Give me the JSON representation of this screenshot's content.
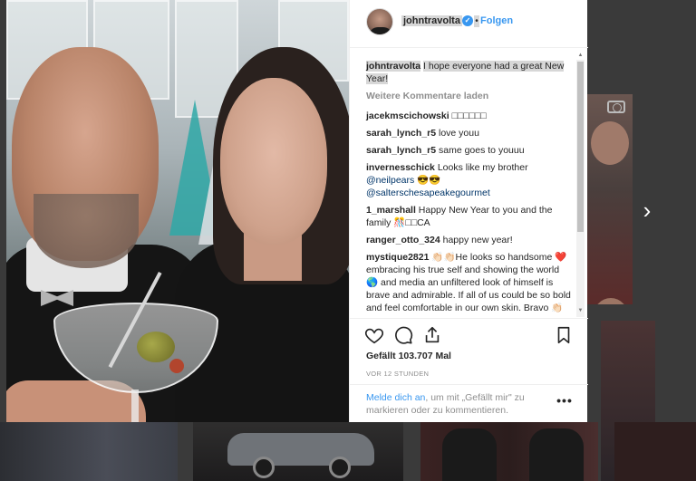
{
  "post": {
    "username": "johntravolta",
    "separator": "•",
    "follow_label": "Folgen",
    "caption_user": "johntravolta",
    "caption_text": "I hope everyone had a great New Year!",
    "load_more_label": "Weitere Kommentare laden",
    "comments": [
      {
        "user": "jacekmscichowski",
        "text": "□□□□□□"
      },
      {
        "user": "sarah_lynch_r5",
        "text": "love youu"
      },
      {
        "user": "sarah_lynch_r5",
        "text": "same goes to youuu"
      },
      {
        "user": "invernesschick",
        "text": "Looks like my brother",
        "mention1": "@neilpears",
        "emoji": "😎😎",
        "mention2": "@salterschesapeakegourmet"
      },
      {
        "user": "1_marshall",
        "text": "Happy New Year to you and the family 🎊□□CA"
      },
      {
        "user": "ranger_otto_324",
        "text": "happy new year!"
      },
      {
        "user": "mystique2821",
        "text_a": "👏🏻👏🏻He looks so handsome",
        "text_b": "❤️embracing his true self and showing the world",
        "text_c": "🌎 and media an unfiltered look of himself is brave and admirable. If all of us could be so bold and feel comfortable in our own skin. Bravo 👏🏻"
      }
    ],
    "likes_text": "Gefällt 103.707 Mal",
    "time_text": "VOR 12 STUNDEN",
    "login_link": "Melde dich an",
    "login_rest": ", um mit „Gefällt mir\" zu markieren oder zu kommentieren.",
    "more_options_glyph": "•••",
    "verified_glyph": "✓",
    "next_glyph": "›"
  },
  "icons": {
    "heart": "heart-icon",
    "comment": "comment-icon",
    "share": "share-icon",
    "bookmark": "bookmark-icon",
    "next": "chevron-right-icon",
    "camera": "camera-icon"
  },
  "colors": {
    "accent": "#3897f0",
    "text": "#262626",
    "muted": "#8e8e8e",
    "highlight": "#d7d7d7"
  }
}
